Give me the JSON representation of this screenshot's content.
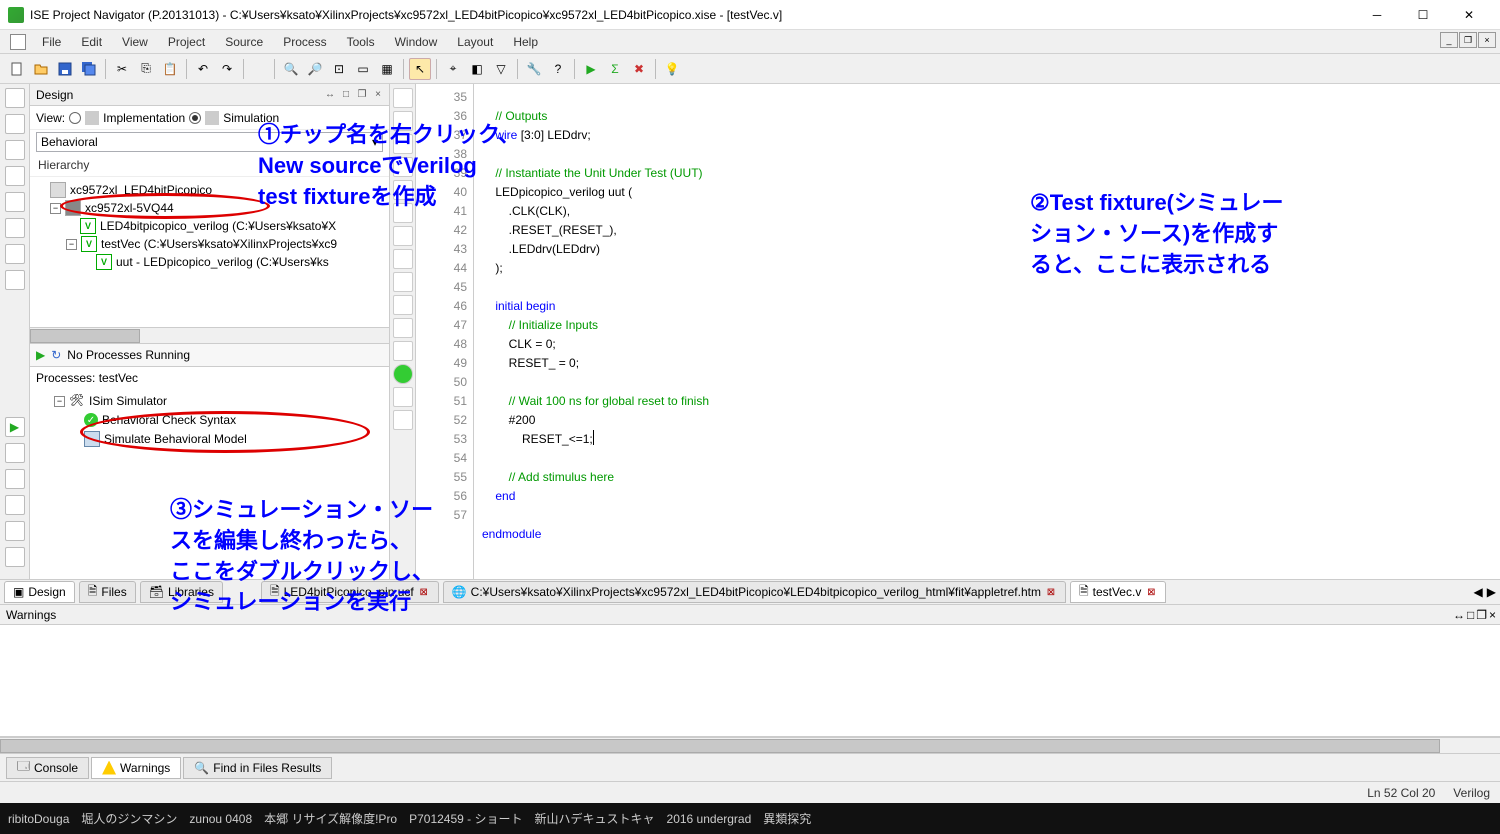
{
  "window": {
    "title": "ISE Project Navigator (P.20131013) - C:¥Users¥ksato¥XilinxProjects¥xc9572xl_LED4bitPicopico¥xc9572xl_LED4bitPicopico.xise - [testVec.v]"
  },
  "menu": {
    "file": "File",
    "edit": "Edit",
    "view": "View",
    "project": "Project",
    "source": "Source",
    "process": "Process",
    "tools": "Tools",
    "window": "Window",
    "layout": "Layout",
    "help": "Help"
  },
  "design": {
    "title": "Design",
    "view_label": "View:",
    "impl": "Implementation",
    "sim": "Simulation",
    "behavioral": "Behavioral",
    "hierarchy": "Hierarchy",
    "nodes": {
      "n0": "xc9572xl_LED4bitPicopico",
      "n1": "xc9572xl-5VQ44",
      "n2": "LED4bitpicopico_verilog (C:¥Users¥ksato¥X",
      "n3": "testVec (C:¥Users¥ksato¥XilinxProjects¥xc9",
      "n4": "uut - LEDpicopico_verilog (C:¥Users¥ks"
    },
    "noproc": "No Processes Running",
    "processes_for": "Processes: testVec",
    "isim": "ISim Simulator",
    "chk": "Behavioral Check Syntax",
    "simrun": "Simulate Behavioral Model"
  },
  "editor": {
    "lines": [
      "35",
      "36",
      "37",
      "38",
      "39",
      "40",
      "41",
      "42",
      "43",
      "44",
      "45",
      "46",
      "47",
      "48",
      "49",
      "50",
      "51",
      "52",
      "53",
      "54",
      "55",
      "56",
      "57"
    ],
    "code": {
      "l35": "// Outputs",
      "l36a": "wire",
      "l36b": " [3:0] LEDdrv;",
      "l37": "",
      "l38": "// Instantiate the Unit Under Test (UUT)",
      "l39": "LEDpicopico_verilog uut (",
      "l40": "    .CLK(CLK), ",
      "l41": "    .RESET_(RESET_), ",
      "l42": "    .LEDdrv(LEDdrv)",
      "l43": ");",
      "l44": "",
      "l45a": "initial",
      "l45b": " begin",
      "l46": "    // Initialize Inputs",
      "l47": "    CLK = 0;",
      "l48": "    RESET_ = 0;",
      "l49": "",
      "l50": "    // Wait 100 ns for global reset to finish",
      "l51": "    #200",
      "l52": "        RESET_<=1;",
      "l53": "",
      "l54": "    // Add stimulus here",
      "l55a": "end",
      "l56": "",
      "l57a": "endmodule"
    }
  },
  "tabs": {
    "design": "Design",
    "files": "Files",
    "libraries": "Libraries",
    "t1": "LED4bitPicopico_pin.ucf",
    "t2": "C:¥Users¥ksato¥XilinxProjects¥xc9572xl_LED4bitPicopico¥LED4bitpicopico_verilog_html¥fit¥appletref.htm",
    "t3": "testVec.v"
  },
  "warnings": {
    "title": "Warnings"
  },
  "bottom": {
    "console": "Console",
    "warnings": "Warnings",
    "find": "Find in Files Results"
  },
  "status": {
    "pos": "Ln 52 Col 20",
    "lang": "Verilog"
  },
  "annotations": {
    "a1": "①チップ名を右クリック、\nNew sourceでVerilog\ntest fixtureを作成",
    "a2": "②Test fixture(シミュレー\nション・ソース)を作成す\nると、ここに表示される",
    "a3": "③シミュレーション・ソー\nスを編集し終わったら、\nここをダブルクリックし、\nシミュレーションを実行"
  },
  "taskbar": {
    "items": [
      "ribitoDouga",
      "堀人のジンマシン",
      "zunou 0408",
      "本郷 リサイズ解像度!Pro",
      "P7012459 - ショート",
      "新山ハデキュストキャ",
      "2016 undergrad",
      "異類探究"
    ]
  }
}
